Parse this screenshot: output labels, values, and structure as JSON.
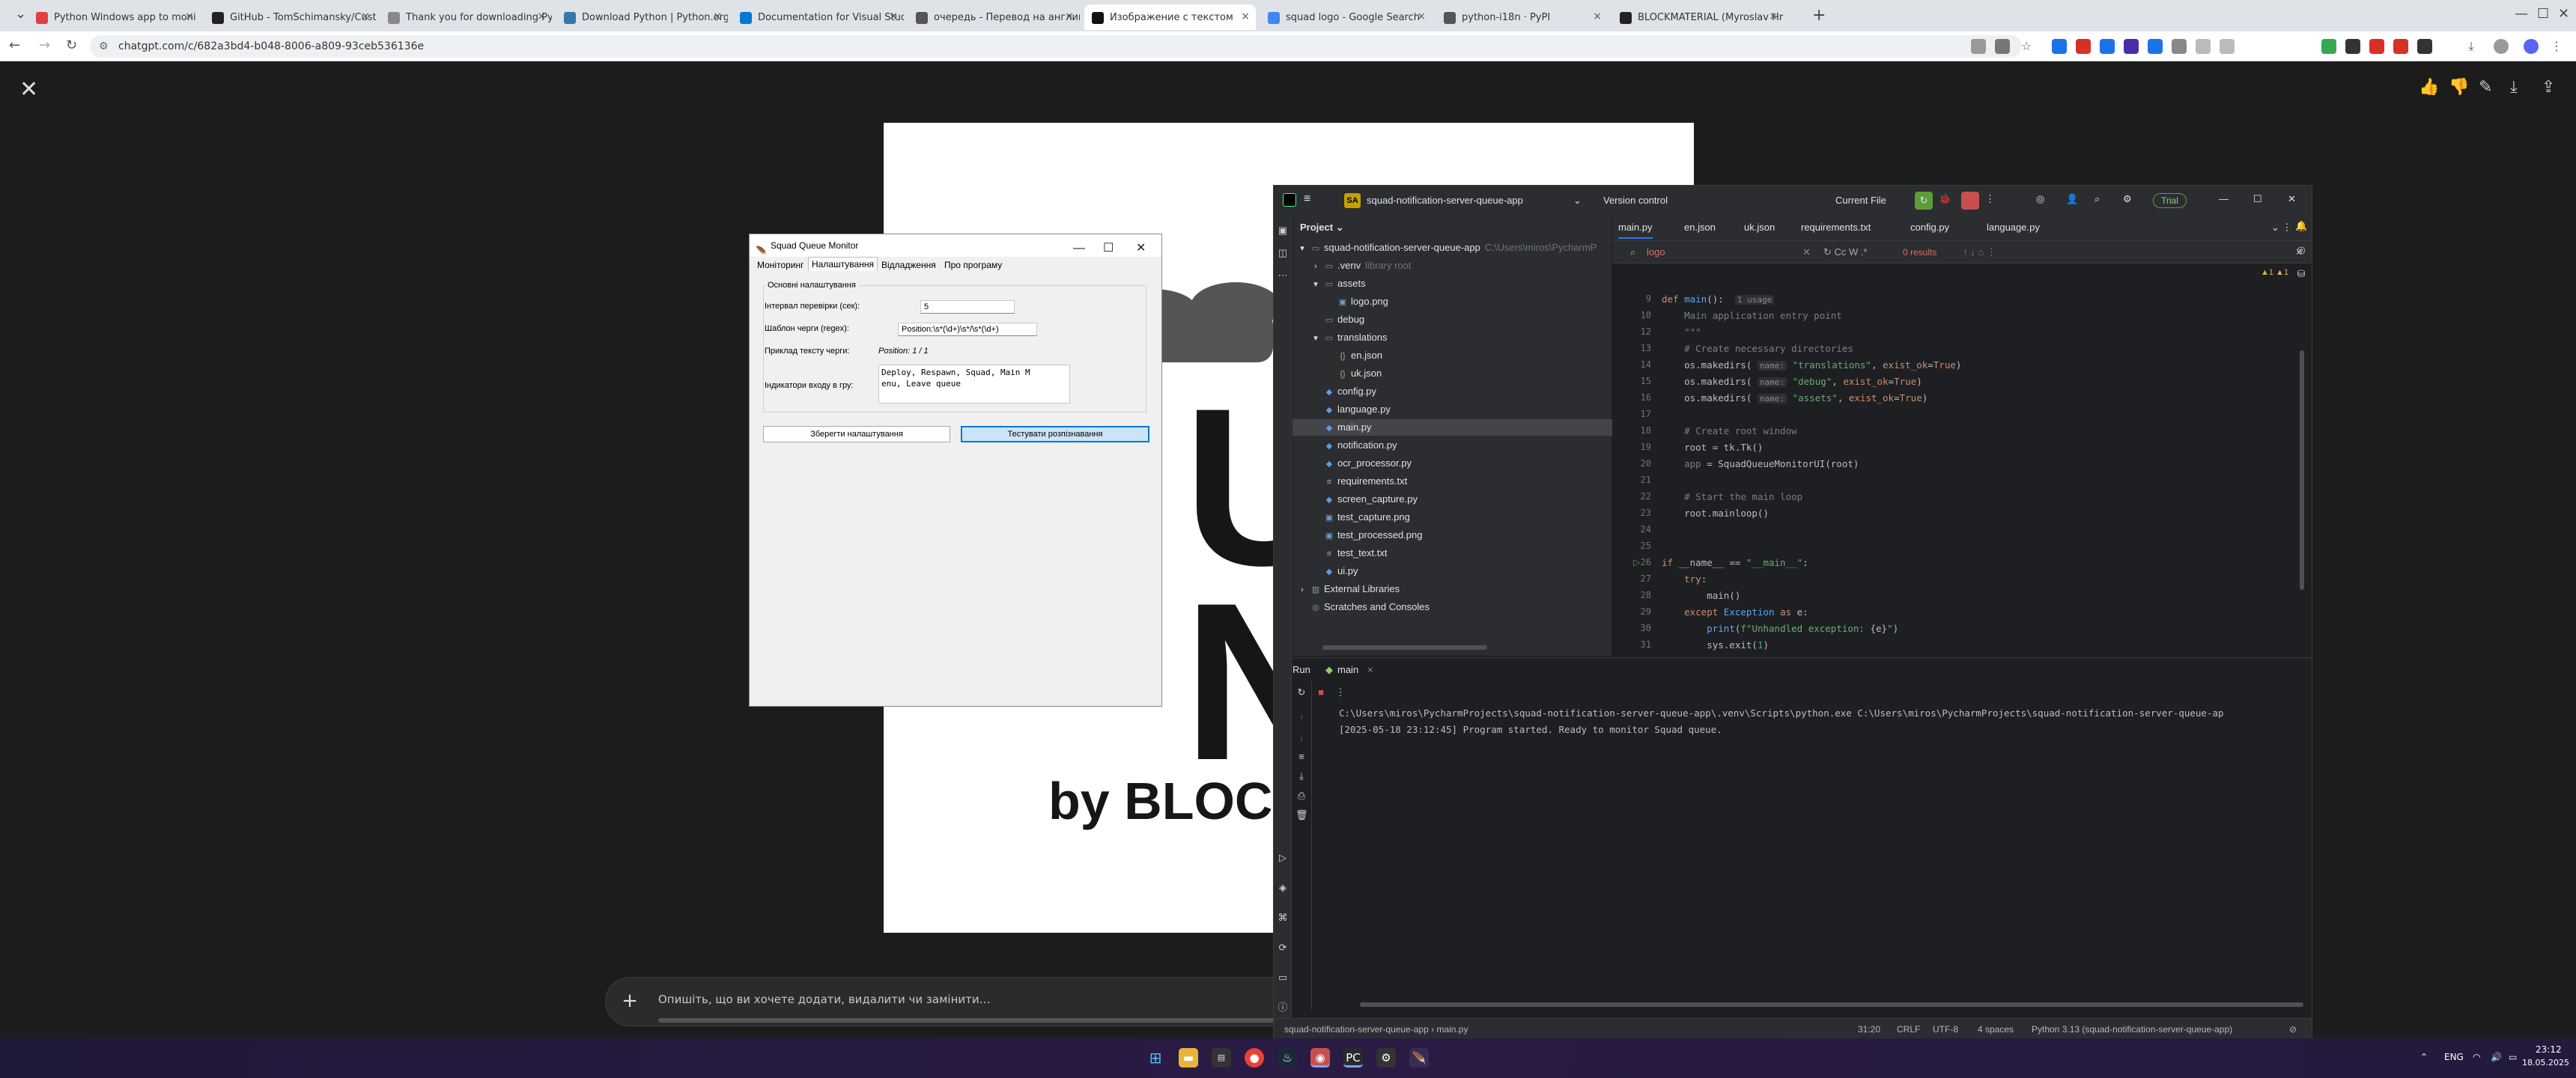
{
  "browser": {
    "tabs": [
      {
        "label": "Python Windows app to moni",
        "icon": "chatgpt-icon",
        "color": "#e04040"
      },
      {
        "label": "GitHub - TomSchimansky/Cust",
        "icon": "github-icon",
        "color": "#222222"
      },
      {
        "label": "Thank you for downloading Py",
        "icon": "generic-icon",
        "color": "#888888"
      },
      {
        "label": "Download Python | Python.org",
        "icon": "python-icon",
        "color": "#3776ab"
      },
      {
        "label": "Documentation for Visual Stud",
        "icon": "vscode-icon",
        "color": "#0078d4"
      },
      {
        "label": "очередь - Перевод на англий",
        "icon": "translate-icon",
        "color": "#555555"
      },
      {
        "label": "Изображение с текстом",
        "icon": "chatgpt-icon",
        "color": "#111111"
      },
      {
        "label": "squad logo - Google Search",
        "icon": "google-icon",
        "color": "#4285f4"
      },
      {
        "label": "python-i18n · PyPI",
        "icon": "pypi-icon",
        "color": "#555555"
      },
      {
        "label": "BLOCKMATERIAL (Myroslav Hr",
        "icon": "github-icon",
        "color": "#222222"
      }
    ],
    "active_tab": 6,
    "url": "chatgpt.com/c/682a3bd4-b048-8006-a809-93ceb536136e"
  },
  "chat": {
    "composer_placeholder": "Опишіть, що ви хочете додати, видалити чи замінити…",
    "image_text_big": "UA\nN",
    "image_text_by": "by BLOCK"
  },
  "tk": {
    "title": "Squad Queue Monitor",
    "tabs": [
      "Моніторинг",
      "Налаштування",
      "Відладження",
      "Про програму"
    ],
    "active_tab": 1,
    "group_title": "Основні налаштування",
    "interval_label": "Інтервал перевірки (сек):",
    "interval_value": "5",
    "regex_label": "Шаблон черги (regex):",
    "regex_value": "Position:\\s*(\\d+)\\s*/\\s*(\\d+)",
    "example_label": "Приклад тексту черги:",
    "example_value": "Position: 1 / 1",
    "indicators_label": "Індикатори входу в гру:",
    "indicators_value": "Deploy, Respawn, Squad, Main M\nenu, Leave queue",
    "save_button": "Зберегти налаштування",
    "test_button": "Тестувати розпізнавання"
  },
  "pycharm": {
    "project_badge": "SA",
    "project_name": "squad-notification-server-queue-app",
    "vcs": "Version control",
    "run_config": "Current File",
    "trial": "Trial",
    "project_header": "Project",
    "tree": [
      {
        "label": "squad-notification-server-queue-app",
        "suffix": "C:\\Users\\miros\\PycharmP",
        "indent": 0,
        "icon": "folder-icon",
        "arrow": "▾"
      },
      {
        "label": ".venv",
        "suffix": "library root",
        "indent": 1,
        "icon": "folder-icon",
        "arrow": "›"
      },
      {
        "label": "assets",
        "suffix": "",
        "indent": 1,
        "icon": "folder-icon",
        "arrow": "▾"
      },
      {
        "label": "logo.png",
        "suffix": "",
        "indent": 2,
        "icon": "image-file-icon",
        "arrow": ""
      },
      {
        "label": "debug",
        "suffix": "",
        "indent": 1,
        "icon": "folder-icon",
        "arrow": ""
      },
      {
        "label": "translations",
        "suffix": "",
        "indent": 1,
        "icon": "folder-icon",
        "arrow": "▾"
      },
      {
        "label": "en.json",
        "suffix": "",
        "indent": 2,
        "icon": "json-file-icon",
        "arrow": ""
      },
      {
        "label": "uk.json",
        "suffix": "",
        "indent": 2,
        "icon": "json-file-icon",
        "arrow": ""
      },
      {
        "label": "config.py",
        "suffix": "",
        "indent": 1,
        "icon": "python-file-icon",
        "arrow": ""
      },
      {
        "label": "language.py",
        "suffix": "",
        "indent": 1,
        "icon": "python-file-icon",
        "arrow": ""
      },
      {
        "label": "main.py",
        "suffix": "",
        "indent": 1,
        "icon": "python-file-icon",
        "arrow": "",
        "selected": true
      },
      {
        "label": "notification.py",
        "suffix": "",
        "indent": 1,
        "icon": "python-file-icon",
        "arrow": ""
      },
      {
        "label": "ocr_processor.py",
        "suffix": "",
        "indent": 1,
        "icon": "python-file-icon",
        "arrow": ""
      },
      {
        "label": "requirements.txt",
        "suffix": "",
        "indent": 1,
        "icon": "text-file-icon",
        "arrow": ""
      },
      {
        "label": "screen_capture.py",
        "suffix": "",
        "indent": 1,
        "icon": "python-file-icon",
        "arrow": ""
      },
      {
        "label": "test_capture.png",
        "suffix": "",
        "indent": 1,
        "icon": "image-file-icon",
        "arrow": ""
      },
      {
        "label": "test_processed.png",
        "suffix": "",
        "indent": 1,
        "icon": "image-file-icon",
        "arrow": ""
      },
      {
        "label": "test_text.txt",
        "suffix": "",
        "indent": 1,
        "icon": "text-file-icon",
        "arrow": ""
      },
      {
        "label": "ui.py",
        "suffix": "",
        "indent": 1,
        "icon": "python-file-icon",
        "arrow": ""
      },
      {
        "label": "External Libraries",
        "suffix": "",
        "indent": 0,
        "icon": "library-icon",
        "arrow": "›"
      },
      {
        "label": "Scratches and Consoles",
        "suffix": "",
        "indent": 0,
        "icon": "scratch-icon",
        "arrow": ""
      }
    ],
    "editor_tabs": [
      "main.py",
      "en.json",
      "uk.json",
      "requirements.txt",
      "config.py",
      "language.py"
    ],
    "active_editor_tab": 0,
    "find_query": "logo",
    "find_results": "0 results",
    "warnings": "▲1 ▲1",
    "code_lines": [
      {
        "n": "9",
        "html": "<span class='kw'>def</span> <span class='fn'>main</span>():  <span class='hint'>1 usage</span>"
      },
      {
        "n": "10",
        "html": "    <span class='cm'>Main application entry point</span>"
      },
      {
        "n": "12",
        "html": "    <span class='cm'>\"\"\"</span>"
      },
      {
        "n": "13",
        "html": "    <span class='cm'># Create necessary directories</span>"
      },
      {
        "n": "14",
        "html": "    os.makedirs( <span class='hint'>name:</span> <span class='str'>\"translations\"</span>, <span class='kw'>exist_ok</span>=<span class='kw'>True</span>)"
      },
      {
        "n": "15",
        "html": "    os.makedirs( <span class='hint'>name:</span> <span class='str'>\"debug\"</span>, <span class='kw'>exist_ok</span>=<span class='kw'>True</span>)"
      },
      {
        "n": "16",
        "html": "    os.makedirs( <span class='hint'>name:</span> <span class='str'>\"assets\"</span>, <span class='kw'>exist_ok</span>=<span class='kw'>True</span>)"
      },
      {
        "n": "17",
        "html": ""
      },
      {
        "n": "18",
        "html": "    <span class='cm'># Create root window</span>"
      },
      {
        "n": "19",
        "html": "    root = tk.Tk()"
      },
      {
        "n": "20",
        "html": "    <span class='cm'>app</span> = SquadQueueMonitorUI(root)"
      },
      {
        "n": "21",
        "html": ""
      },
      {
        "n": "22",
        "html": "    <span class='cm'># Start the main loop</span>"
      },
      {
        "n": "23",
        "html": "    root.mainloop()"
      },
      {
        "n": "24",
        "html": ""
      },
      {
        "n": "25",
        "html": ""
      },
      {
        "n": "26",
        "html": "<span class='kw'>if</span> __name__ == <span class='str'>\"__main__\"</span>:"
      },
      {
        "n": "27",
        "html": "    <span class='kw'>try</span>:"
      },
      {
        "n": "28",
        "html": "        main()"
      },
      {
        "n": "29",
        "html": "    <span class='kw'>except</span> <span class='fn'>Exception</span> <span class='kw'>as</span> e:"
      },
      {
        "n": "30",
        "html": "        <span class='fn'>print</span>(<span class='str'>f\"Unhandled exception: </span>{e}<span class='str'>\"</span>)"
      },
      {
        "n": "31",
        "html": "        sys.exit(<span class='num'>1</span>)"
      }
    ],
    "run_tab": "Run",
    "run_config_tab": "main",
    "console": [
      "C:\\Users\\miros\\PycharmProjects\\squad-notification-server-queue-app\\.venv\\Scripts\\python.exe C:\\Users\\miros\\PycharmProjects\\squad-notification-server-queue-ap",
      "[2025-05-18 23:12:45] Program started. Ready to monitor Squad queue."
    ],
    "breadcrumb_project": "squad-notification-server-queue-app",
    "breadcrumb_file": "main.py",
    "status": {
      "position": "31:20",
      "line_sep": "CRLF",
      "encoding": "UTF-8",
      "indent": "4 spaces",
      "interpreter": "Python 3.13 (squad-notification-server-queue-app)"
    }
  },
  "taskbar": {
    "lang": "ENG",
    "time": "23:12",
    "date": "18.05.2025"
  }
}
